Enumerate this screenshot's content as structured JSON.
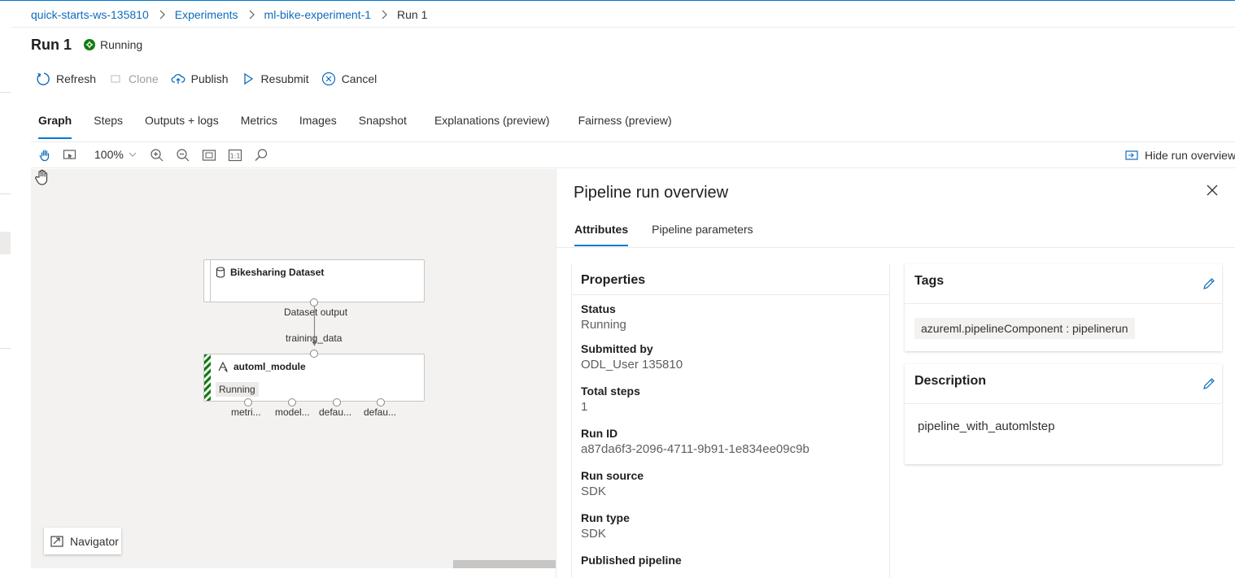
{
  "breadcrumb": {
    "workspace": "quick-starts-ws-135810",
    "experiments": "Experiments",
    "experiment": "ml-bike-experiment-1",
    "current": "Run 1"
  },
  "header": {
    "title": "Run 1",
    "status": "Running",
    "status_color": "#107c10"
  },
  "commands": {
    "refresh": "Refresh",
    "clone": "Clone",
    "publish": "Publish",
    "resubmit": "Resubmit",
    "cancel": "Cancel"
  },
  "tabs": [
    {
      "label": "Graph"
    },
    {
      "label": "Steps"
    },
    {
      "label": "Outputs + logs"
    },
    {
      "label": "Metrics"
    },
    {
      "label": "Images"
    },
    {
      "label": "Snapshot"
    },
    {
      "label": "Explanations (preview)"
    },
    {
      "label": "Fairness (preview)"
    }
  ],
  "graph_toolbar": {
    "zoom": "100%",
    "hide_overview": "Hide run overview"
  },
  "graph": {
    "dataset_node": {
      "title": "Bikesharing Dataset",
      "output_label": "Dataset output"
    },
    "edge_label": "training_data",
    "automl_node": {
      "title": "automl_module",
      "status": "Running",
      "outputs": [
        "metri...",
        "model...",
        "defau...",
        "defau..."
      ]
    },
    "navigator": "Navigator"
  },
  "overview": {
    "title": "Pipeline run overview",
    "tabs": {
      "attributes": "Attributes",
      "parameters": "Pipeline parameters"
    },
    "properties": {
      "heading": "Properties",
      "items": [
        {
          "label": "Status",
          "value": "Running"
        },
        {
          "label": "Submitted by",
          "value": "ODL_User 135810"
        },
        {
          "label": "Total steps",
          "value": "1"
        },
        {
          "label": "Run ID",
          "value": "a87da6f3-2096-4711-9b91-1e834ee09c9b"
        },
        {
          "label": "Run source",
          "value": "SDK"
        },
        {
          "label": "Run type",
          "value": "SDK"
        },
        {
          "label": "Published pipeline",
          "value": ""
        }
      ]
    },
    "tags": {
      "heading": "Tags",
      "items": [
        "azureml.pipelineComponent : pipelinerun"
      ]
    },
    "description": {
      "heading": "Description",
      "text": "pipeline_with_automlstep"
    }
  },
  "colors": {
    "accent": "#0078d4",
    "link": "#0f6cbd",
    "running": "#107c10"
  }
}
